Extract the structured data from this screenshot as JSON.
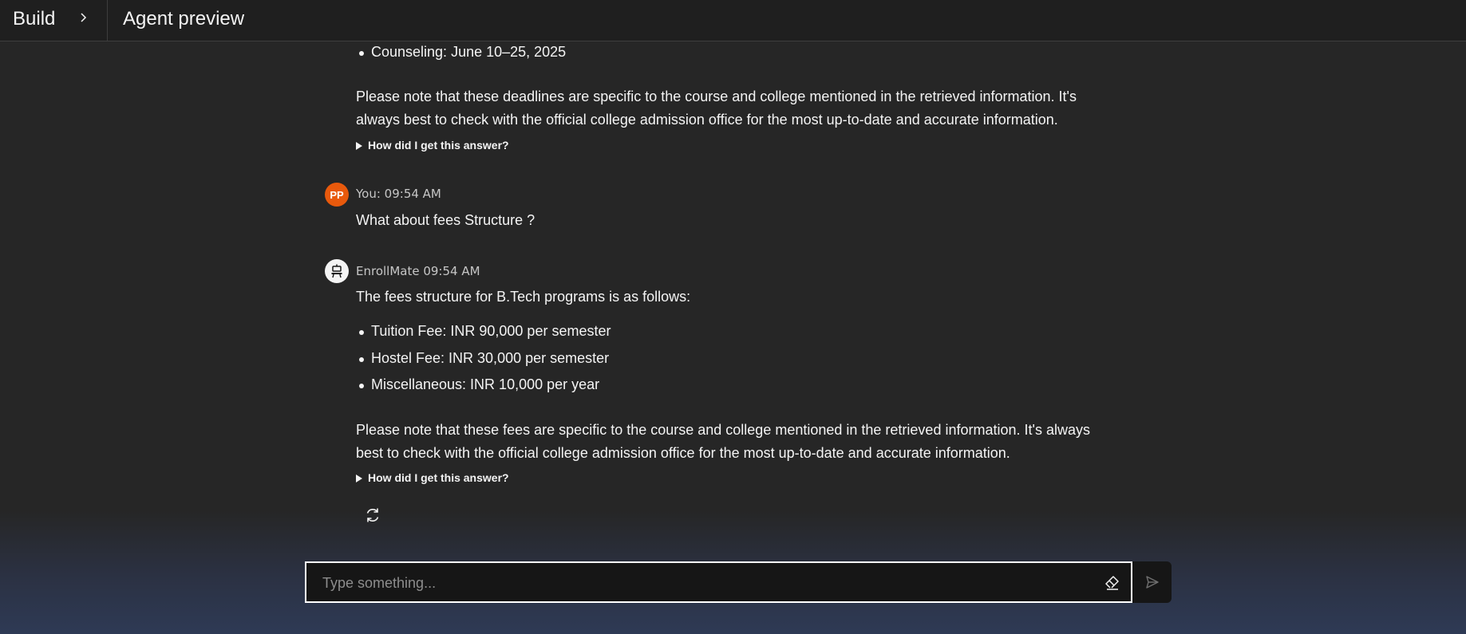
{
  "header": {
    "crumb_build": "Build",
    "crumb_sep_icon": "chevron-right-icon",
    "title": "Agent preview"
  },
  "chat": {
    "prev_answer": {
      "bullet": "Counseling: June 10–25, 2025",
      "note": "Please note that these deadlines are specific to the course and college mentioned in the retrieved information. It's always best to check with the official college admission office for the most up-to-date and accurate information.",
      "how_label": "How did I get this answer?"
    },
    "user_message": {
      "avatar_initials": "PP",
      "meta": "You: 09:54 AM",
      "text": "What about fees Structure ?"
    },
    "bot_message": {
      "meta": "EnrollMate 09:54 AM",
      "intro": "The fees structure for B.Tech programs is as follows:",
      "bullets": [
        "Tuition Fee: INR 90,000 per semester",
        "Hostel Fee: INR 30,000 per semester",
        "Miscellaneous: INR 10,000 per year"
      ],
      "note": "Please note that these fees are specific to the course and college mentioned in the retrieved information. It's always best to check with the official college admission office for the most up-to-date and accurate information.",
      "how_label": "How did I get this answer?"
    }
  },
  "composer": {
    "placeholder": "Type something...",
    "value": "",
    "clear_icon": "eraser-icon",
    "send_icon": "send-icon"
  },
  "colors": {
    "background": "#262626",
    "user_avatar": "#e8590c",
    "text": "#f4f4f4"
  }
}
